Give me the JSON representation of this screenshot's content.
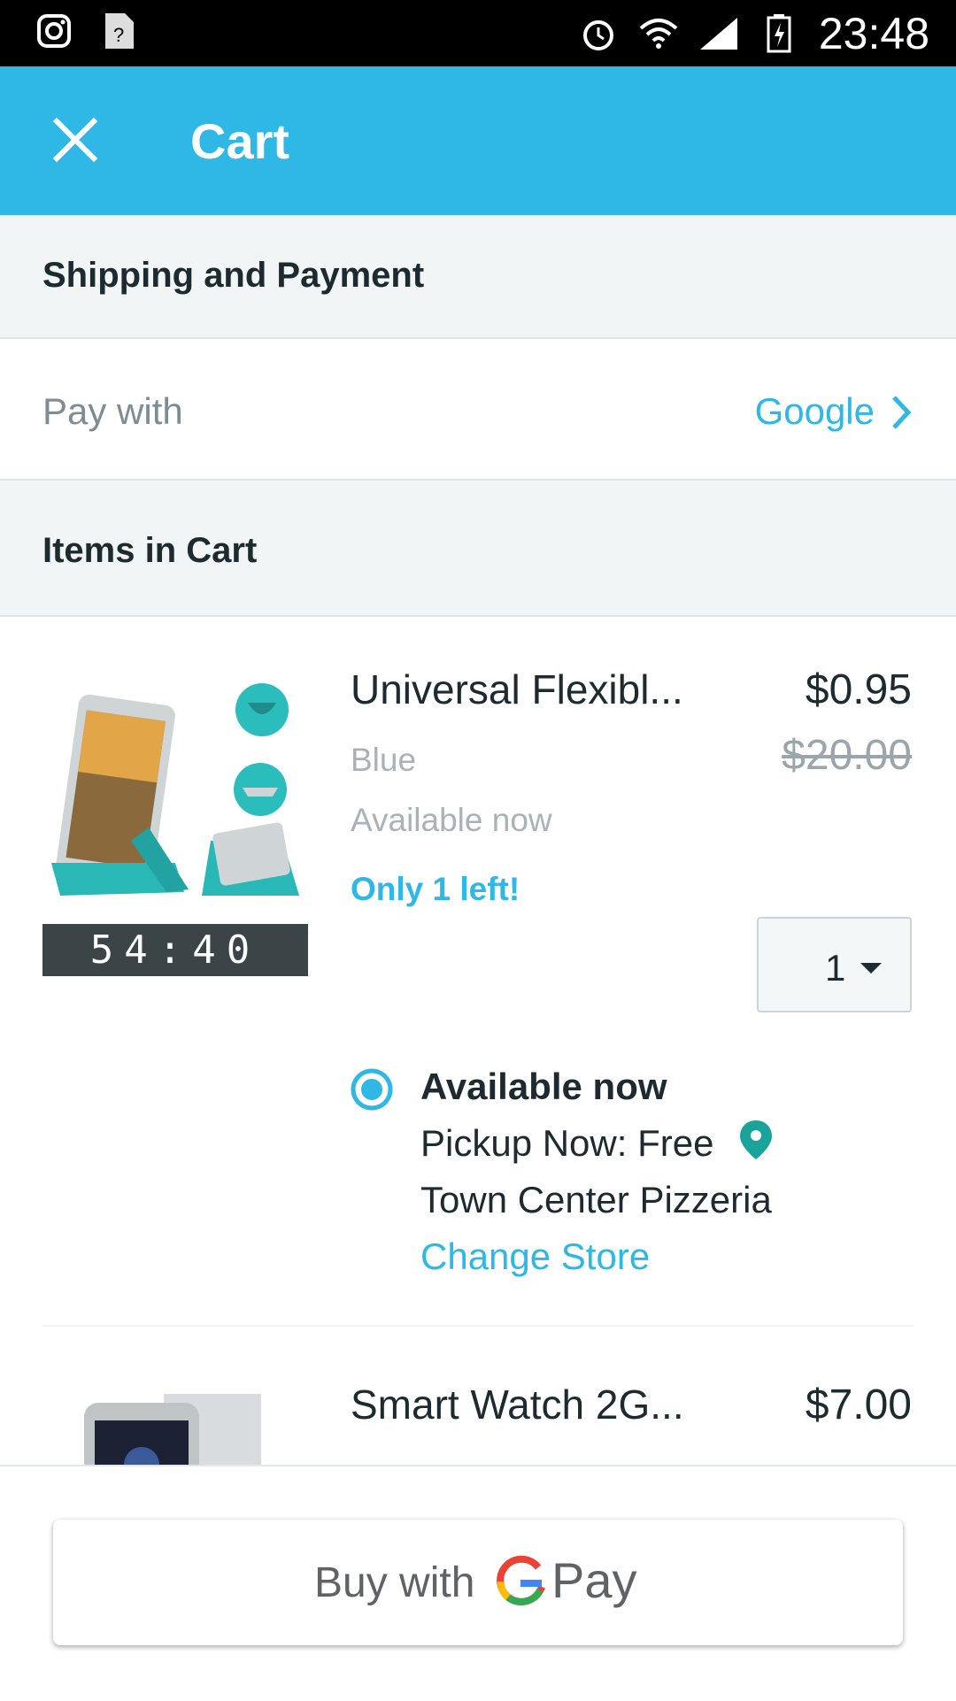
{
  "status_bar": {
    "time": "23:48"
  },
  "app_bar": {
    "title": "Cart"
  },
  "shipping_section": {
    "title": "Shipping and Payment"
  },
  "pay_with": {
    "label": "Pay with",
    "value": "Google"
  },
  "items_section": {
    "title": "Items in Cart"
  },
  "items": [
    {
      "name": "Universal Flexibl...",
      "price": "$0.95",
      "old_price": "$20.00",
      "variant": "Blue",
      "availability": "Available now",
      "stock_note": "Only 1 left!",
      "timer": "54:40",
      "quantity": "1",
      "pickup": {
        "title": "Available now",
        "line": "Pickup Now: Free",
        "store": "Town Center Pizzeria",
        "change_label": "Change Store"
      }
    },
    {
      "name": "Smart Watch 2G...",
      "price": "$7.00"
    }
  ],
  "bottom": {
    "buy_label": "Buy with",
    "pay_label": "Pay"
  },
  "colors": {
    "accent": "#2fb7e6",
    "text": "#1d2b31",
    "muted": "#7d8d94"
  }
}
